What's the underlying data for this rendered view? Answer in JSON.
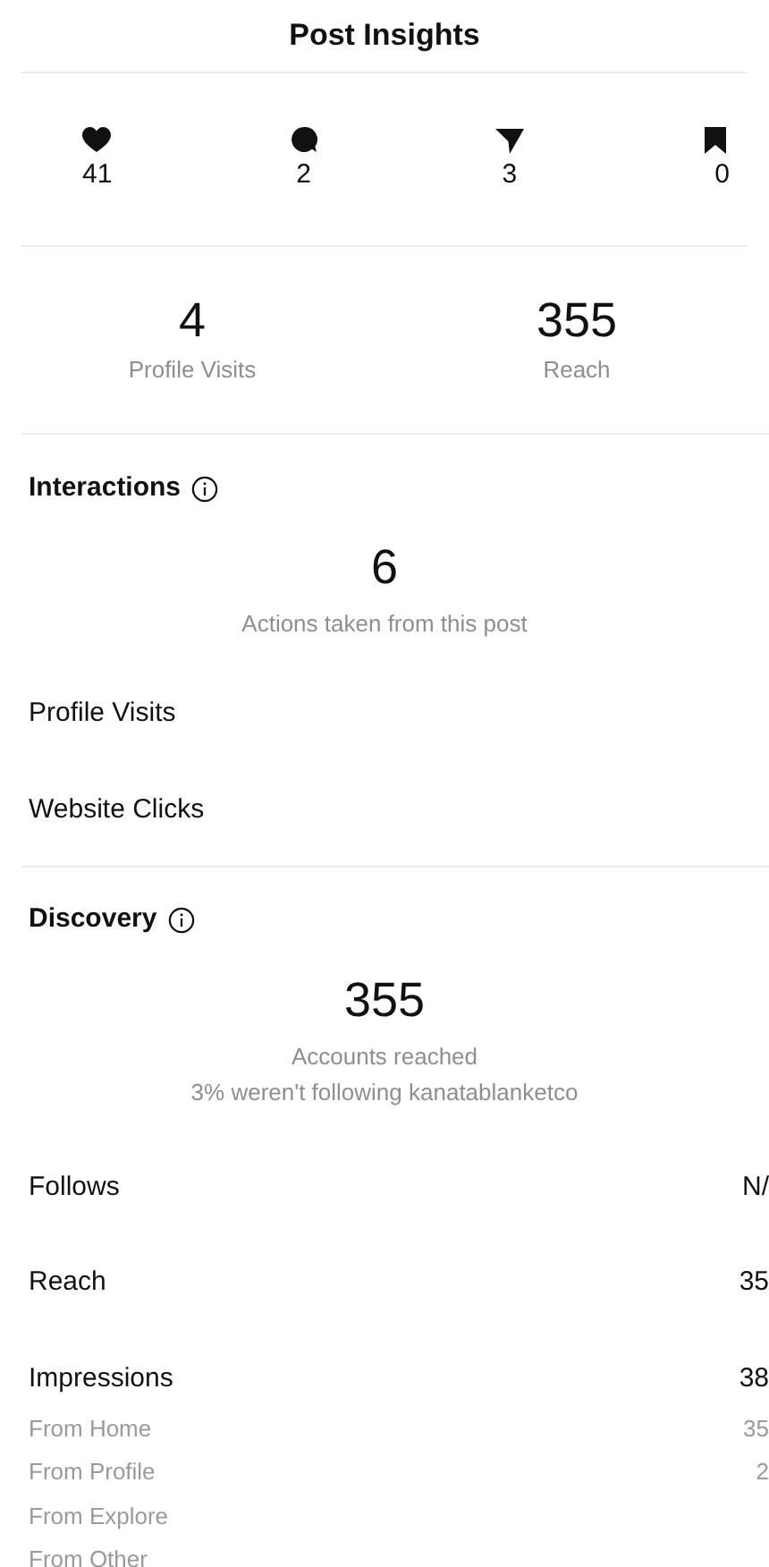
{
  "title": "Post Insights",
  "engagement": [
    {
      "kind": "likes",
      "count": "41"
    },
    {
      "kind": "comments",
      "count": "2"
    },
    {
      "kind": "shares",
      "count": "3"
    },
    {
      "kind": "saves",
      "count": "0"
    }
  ],
  "summary": [
    {
      "value": "4",
      "label": "Profile Visits"
    },
    {
      "value": "355",
      "label": "Reach"
    }
  ],
  "interactions": {
    "heading": "Interactions",
    "total": "6",
    "caption": "Actions taken from this post",
    "rows": [
      {
        "label": "Profile Visits"
      },
      {
        "label": "Website Clicks"
      }
    ]
  },
  "discovery": {
    "heading": "Discovery",
    "total": "355",
    "caption": "Accounts reached",
    "note": "3% weren't following kanatablanketco",
    "rows": [
      {
        "kind": "main",
        "label": "Follows",
        "value": "N/"
      },
      {
        "kind": "main",
        "label": "Reach",
        "value": "35"
      },
      {
        "kind": "main",
        "label": "Impressions",
        "value": "38"
      },
      {
        "kind": "sub",
        "label": "From Home",
        "value": "35"
      },
      {
        "kind": "sub",
        "label": "From Profile",
        "value": "2"
      },
      {
        "kind": "sub",
        "label": "From Explore"
      },
      {
        "kind": "sub",
        "label": "From Other"
      }
    ]
  }
}
